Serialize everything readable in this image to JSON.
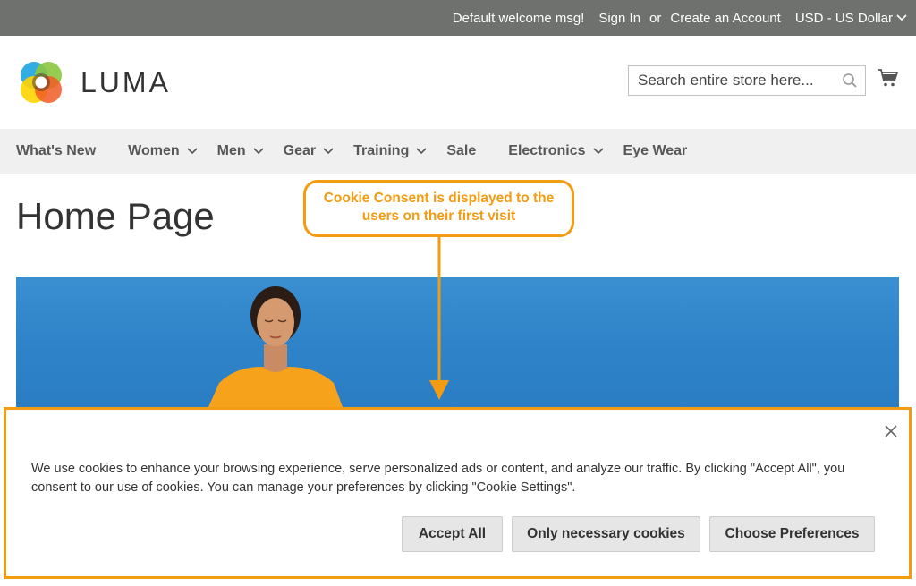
{
  "topbar": {
    "welcome": "Default welcome msg!",
    "sign_in": "Sign In",
    "or": "or",
    "create_account": "Create an Account",
    "currency": "USD - US Dollar"
  },
  "header": {
    "logo_text": "LUMA",
    "search_placeholder": "Search entire store here...",
    "search_icon": "search-icon",
    "cart_icon": "cart-icon"
  },
  "nav": {
    "items": [
      {
        "label": "What's New"
      },
      {
        "label": "Women"
      },
      {
        "label": "Men"
      },
      {
        "label": "Gear"
      },
      {
        "label": "Training"
      },
      {
        "label": "Sale"
      },
      {
        "label": "Electronics"
      },
      {
        "label": "Eye Wear"
      }
    ]
  },
  "page": {
    "title": "Home Page"
  },
  "annotation": {
    "callout": "Cookie Consent is displayed to the users on their first visit",
    "color": "#f39c12"
  },
  "cookie": {
    "message": "We use cookies to enhance your browsing experience, serve personalized ads or content, and analyze our traffic. By clicking \"Accept All\", you consent to our use of cookies. You can manage your preferences by clicking \"Cookie Settings\".",
    "accept_all": "Accept All",
    "only_necessary": "Only necessary cookies",
    "choose_preferences": "Choose Preferences",
    "close_icon": "close-icon"
  },
  "colors": {
    "topbar_bg": "#6e716e",
    "nav_bg": "#f0f0f0",
    "accent": "#f39c12",
    "hero_blue": "#2f84c9"
  }
}
